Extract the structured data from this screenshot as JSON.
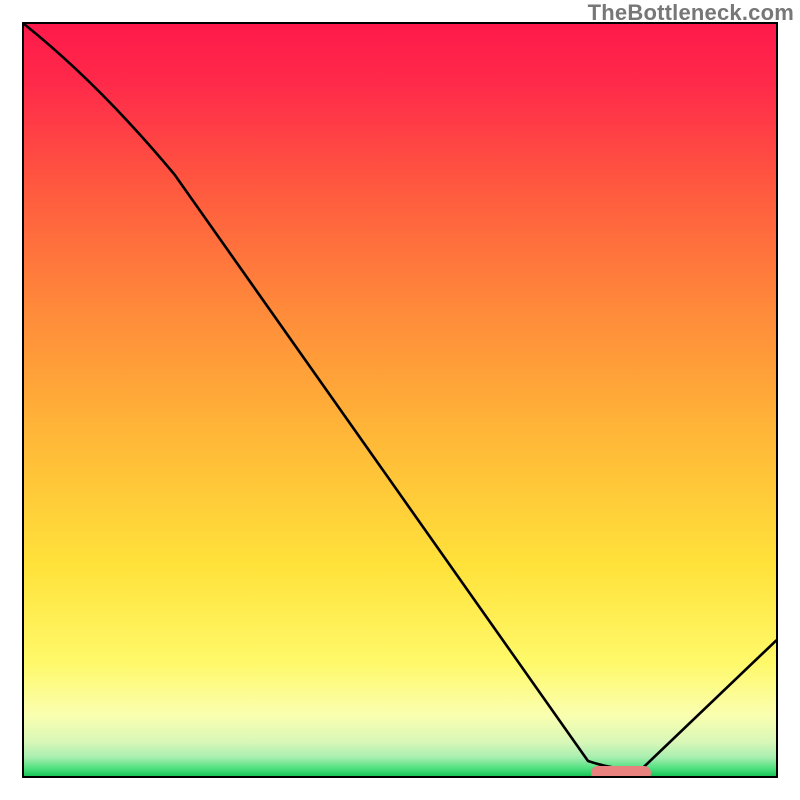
{
  "watermark": {
    "text": "TheBottleneck.com"
  },
  "chart_data": {
    "type": "line",
    "title": "",
    "xlabel": "",
    "ylabel": "",
    "xlim": [
      0,
      100
    ],
    "ylim": [
      0,
      100
    ],
    "series": [
      {
        "name": "bottleneck-curve",
        "x": [
          0,
          20,
          75,
          82,
          100
        ],
        "values": [
          100,
          80,
          2,
          0.8,
          18
        ]
      }
    ],
    "gradient_stops": [
      {
        "pos": 0.0,
        "color": "#ff1a4b"
      },
      {
        "pos": 0.08,
        "color": "#ff2a4a"
      },
      {
        "pos": 0.22,
        "color": "#ff5a3f"
      },
      {
        "pos": 0.38,
        "color": "#ff8a3a"
      },
      {
        "pos": 0.55,
        "color": "#ffb838"
      },
      {
        "pos": 0.72,
        "color": "#ffe23a"
      },
      {
        "pos": 0.85,
        "color": "#fff96a"
      },
      {
        "pos": 0.92,
        "color": "#faffb0"
      },
      {
        "pos": 0.955,
        "color": "#d8f7b8"
      },
      {
        "pos": 0.975,
        "color": "#a8efb0"
      },
      {
        "pos": 0.99,
        "color": "#4ee07e"
      },
      {
        "pos": 1.0,
        "color": "#18c558"
      }
    ],
    "minimum_highlight": {
      "x_start": 75,
      "x_end": 83,
      "y": 0.9,
      "color": "#e8827f"
    }
  }
}
